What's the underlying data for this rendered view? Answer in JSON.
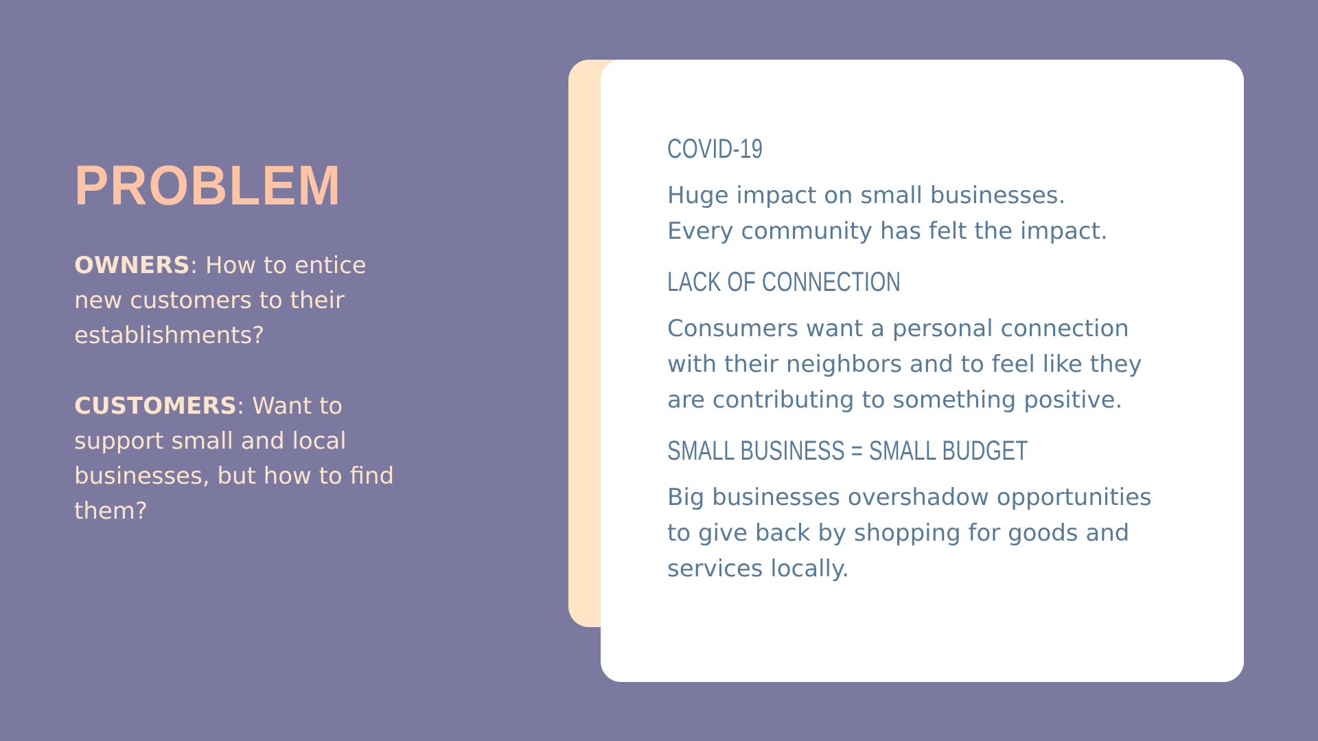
{
  "title": "PROBLEM",
  "left": {
    "owners_label": "OWNERS",
    "owners_text": ": How to entice new customers to their establishments?",
    "customers_label": "CUSTOMERS",
    "customers_text": ": Want to support small and local businesses, but how to find them?"
  },
  "card": {
    "sections": [
      {
        "heading": "COVID-19",
        "lines": [
          "Huge impact on small businesses.",
          "Every community has felt the impact."
        ]
      },
      {
        "heading": "LACK OF CONNECTION",
        "lines": [
          "Consumers want a personal connection",
          "with their neighbors and to feel like they",
          "are contributing to something positive."
        ]
      },
      {
        "heading": "SMALL BUSINESS = SMALL BUDGET",
        "lines": [
          "Big businesses overshadow opportunities",
          "to give back by shopping for goods and",
          "services locally."
        ]
      }
    ]
  },
  "colors": {
    "background": "#7b79a0",
    "title": "#fec4a4",
    "left_text": "#fde5cb",
    "card": "#ffffff",
    "card_accent": "#fee5c5",
    "card_text": "#567a99"
  }
}
